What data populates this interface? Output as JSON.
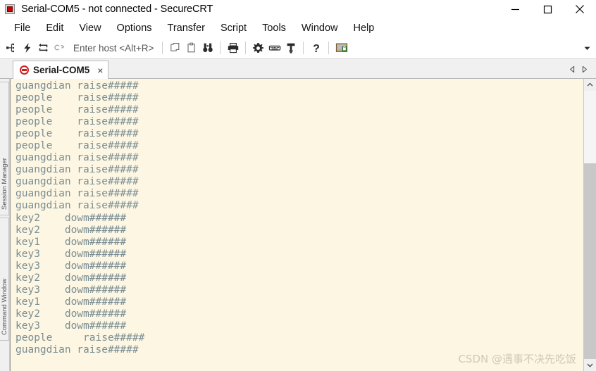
{
  "window": {
    "title": "Serial-COM5 - not connected - SecureCRT",
    "app_icon": "securecrt-icon",
    "minimize_label": "Minimize",
    "maximize_label": "Maximize",
    "close_label": "Close"
  },
  "menubar": {
    "items": [
      {
        "label": "File"
      },
      {
        "label": "Edit"
      },
      {
        "label": "View"
      },
      {
        "label": "Options"
      },
      {
        "label": "Transfer"
      },
      {
        "label": "Script"
      },
      {
        "label": "Tools"
      },
      {
        "label": "Window"
      },
      {
        "label": "Help"
      }
    ]
  },
  "toolbar": {
    "host_placeholder": "Enter host <Alt+R>",
    "host_value": "",
    "icons": [
      {
        "name": "new-session-icon",
        "title": "New Session"
      },
      {
        "name": "quick-connect-icon",
        "title": "Quick Connect"
      },
      {
        "name": "reconnect-icon",
        "title": "Reconnect"
      },
      {
        "name": "disconnect-icon",
        "title": "Disconnect"
      },
      {
        "name": "copy-icon",
        "title": "Copy"
      },
      {
        "name": "paste-icon",
        "title": "Paste"
      },
      {
        "name": "find-icon",
        "title": "Find"
      },
      {
        "name": "print-icon",
        "title": "Print"
      },
      {
        "name": "session-options-icon",
        "title": "Session Options"
      },
      {
        "name": "keymap-editor-icon",
        "title": "Keymap Editor"
      },
      {
        "name": "key-icon",
        "title": "Public Key"
      },
      {
        "name": "help-icon",
        "title": "Help"
      },
      {
        "name": "secure-shell-icon",
        "title": "Secure Shell"
      }
    ],
    "overflow_label": "Toolbar options"
  },
  "tabs": {
    "items": [
      {
        "label": "Serial-COM5",
        "status_icon": "disconnected-icon",
        "close_label": "×",
        "active": true
      }
    ],
    "nav_prev_label": "Previous tab",
    "nav_next_label": "Next tab"
  },
  "sidebar": {
    "rails": [
      {
        "label": "Session Manager"
      },
      {
        "label": "Command Window"
      }
    ]
  },
  "terminal": {
    "background": "#fdf6e3",
    "foreground": "#7b8e93",
    "lines": [
      "guangdian raise#####",
      "people    raise#####",
      "people    raise#####",
      "people    raise#####",
      "people    raise#####",
      "people    raise#####",
      "guangdian raise#####",
      "guangdian raise#####",
      "guangdian raise#####",
      "guangdian raise#####",
      "guangdian raise#####",
      "key2    dowm######",
      "key2    dowm######",
      "key1    dowm######",
      "key3    dowm######",
      "key3    dowm######",
      "key2    dowm######",
      "key3    dowm######",
      "key1    dowm######",
      "key2    dowm######",
      "key3    dowm######",
      "people     raise#####",
      "guangdian raise#####"
    ]
  },
  "scrollbar": {
    "up_label": "Scroll up",
    "down_label": "Scroll down",
    "thumb_top_pct": 27,
    "thumb_height_pct": 73
  },
  "watermark": {
    "text": "CSDN @遇事不决先吃饭"
  }
}
